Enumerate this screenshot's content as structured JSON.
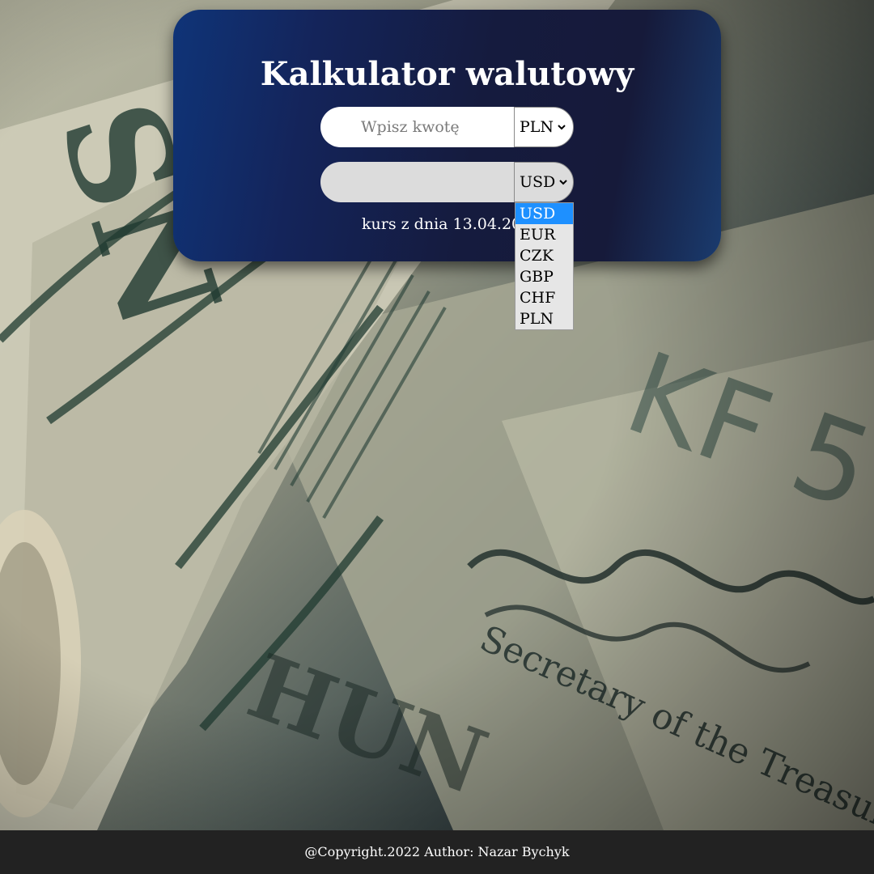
{
  "calculator": {
    "title": "Kalkulator walutowy",
    "amount_placeholder": "Wpisz kwotę",
    "amount_value": "",
    "from_currency": "PLN",
    "to_currency": "USD",
    "result_value": "",
    "rate_date_text": "kurs z dnia 13.04.20"
  },
  "dropdown": {
    "options": [
      "USD",
      "EUR",
      "CZK",
      "GBP",
      "CHF",
      "PLN"
    ],
    "selected": "USD"
  },
  "footer": {
    "text": "@Copyright.2022 Author: Nazar Bychyk"
  },
  "colors": {
    "card_start": "#0f3478",
    "card_end": "#161a3a",
    "selected_option": "#1e90ff",
    "footer_bg": "#222222"
  }
}
